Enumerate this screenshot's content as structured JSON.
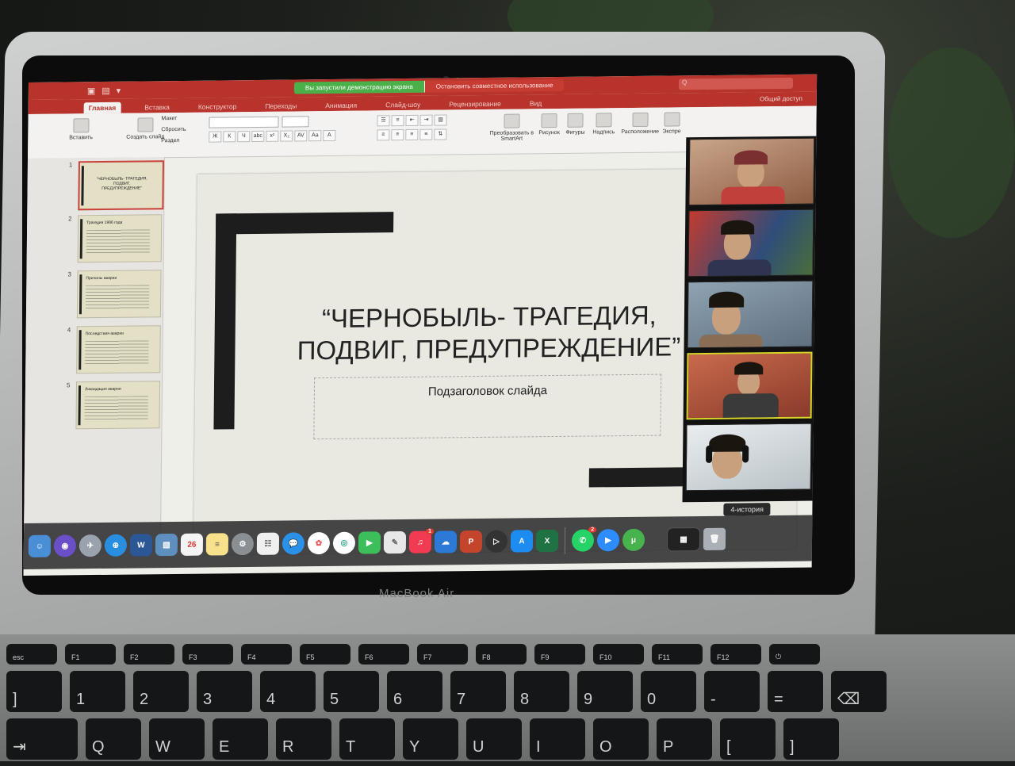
{
  "titlebar": {
    "share_banner": "Вы запустили демонстрацию экрана",
    "stop_banner": "Остановить совместное использование",
    "search_placeholder": "Q"
  },
  "tabs": [
    "Главная",
    "Вставка",
    "Конструктор",
    "Переходы",
    "Анимация",
    "Слайд-шоу",
    "Рецензирование",
    "Вид"
  ],
  "share_button": "Общий доступ",
  "ribbon": {
    "paste": "Вставить",
    "new_slide": "Создать слайд",
    "layout": "Макет",
    "reset": "Сбросить",
    "section": "Раздел",
    "convert_smartart": "Преобразовать в SmartArt",
    "picture": "Рисунок",
    "shapes": "Фигуры",
    "textbox": "Надпись",
    "arrange": "Расположение",
    "express": "Экспре"
  },
  "thumbnails": [
    {
      "num": "1",
      "title": "“ЧЕРНОБЫЛЬ- ТРАГЕДИЯ, ПОДВИГ, ПРЕДУПРЕЖДЕНИЕ”"
    },
    {
      "num": "2",
      "title": "Трагедия 1986 года"
    },
    {
      "num": "3",
      "title": "Причины аварии"
    },
    {
      "num": "4",
      "title": "Последствия аварии"
    },
    {
      "num": "5",
      "title": "Ликвидация аварии"
    }
  ],
  "slide": {
    "title": "“ЧЕРНОБЫЛЬ- ТРАГЕДИЯ, ПОДВИГ, ПРЕДУПРЕЖДЕНИЕ”",
    "subtitle": "Подзаголовок слайда"
  },
  "zoom": {
    "tooltip": "4-история"
  },
  "dock": {
    "calendar_day": "26",
    "word_label": "W",
    "excel_label": "X",
    "ppt_label": "P",
    "utorrent_label": "μ",
    "music_badge": "1",
    "whatsapp_badge": "2"
  },
  "laptop_label": "MacBook Air"
}
